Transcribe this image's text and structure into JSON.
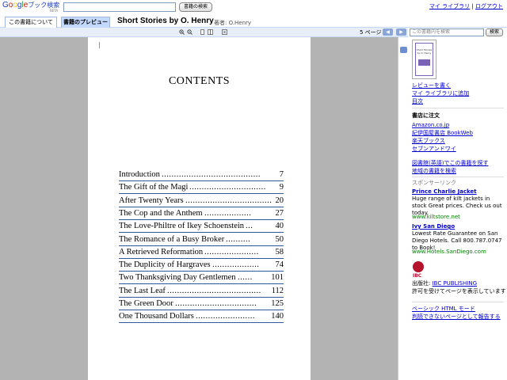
{
  "header": {
    "logo": {
      "g1": "G",
      "o1": "o",
      "o2": "o",
      "g2": "g",
      "l": "l",
      "e": "e",
      "jp": "ブック検索"
    },
    "logo_sub": "BETA",
    "search_button": "書籍の検索",
    "my_library": "マイ ライブラリ",
    "separator": "|",
    "logout": "ログアウト"
  },
  "tabs": {
    "about": "この書籍について",
    "preview": "書籍のプレビュー"
  },
  "book": {
    "title": "Short Stories by O. Henry",
    "author_label": "著者: O.Henry"
  },
  "toolbar": {
    "page_indicator": "5 ページ",
    "prev": "◀",
    "next": "▶"
  },
  "page": {
    "heading": "CONTENTS",
    "toc": [
      {
        "title": "Introduction",
        "dots": "........................................",
        "page": "7"
      },
      {
        "title": "The Gift of the Magi",
        "dots": "...............................",
        "page": "9"
      },
      {
        "title": "After Twenty Years",
        "dots": ".....................................",
        "page": "20"
      },
      {
        "title": "The Cop and the Anthem",
        "dots": "...................",
        "page": "27"
      },
      {
        "title": "The Love-Philtre of Ikey Schoenstein",
        "dots": "...",
        "page": "40"
      },
      {
        "title": "The Romance of a Busy Broker",
        "dots": "..........",
        "page": "50"
      },
      {
        "title": "A Retrieved Reformation",
        "dots": "......................",
        "page": "58"
      },
      {
        "title": "The Duplicity of Hargraves",
        "dots": "...................",
        "page": "74"
      },
      {
        "title": "Two Thanksgiving Day Gentlemen",
        "dots": "......",
        "page": "101"
      },
      {
        "title": "The Last Leaf",
        "dots": "......................................",
        "page": "112"
      },
      {
        "title": "The Green Door",
        "dots": ".................................",
        "page": "125"
      },
      {
        "title": "One Thousand Dollars",
        "dots": "........................",
        "page": "140"
      }
    ]
  },
  "sidebar": {
    "inbook_search_placeholder": "この書籍内を検索",
    "inbook_search_button": "検索",
    "cover_text": "Short Stories by O. Henry",
    "write_review": "レビューを書く",
    "add_to_library": "マイ ライブラリに追加",
    "toc_link": "目次",
    "buy_heading": "書店に注文",
    "stores": [
      "Amazon.co.jp",
      "紀伊国屋書店 BookWeb",
      "楽天ブックス",
      "セブンアンドワイ"
    ],
    "library_links": [
      "図書館(英語)でこの書籍を探す",
      "地域の書籍を検索"
    ],
    "sponsored_label": "スポンサーリンク",
    "ads": [
      {
        "title": "Prince Charlie Jacket",
        "text": "Huge range of kilt jackets in stock Great prices. Check us out today.",
        "url": "www.kiltstore.net"
      },
      {
        "title": "Ivy San Diego",
        "text": "Lowest Rate Guarantee on San Diego Hotels. Call 800.787.0747 to Book!",
        "url": "www.Hotels.SanDiego.com"
      }
    ],
    "publisher_logo_text": "IBC",
    "publisher_label": "出版社:",
    "publisher_name": "IBC PUBLISHING",
    "permission": "許可を受けてページを表示しています",
    "footer_links": [
      "ベーシック HTML モード",
      "判読できないページとして報告する"
    ]
  },
  "colors": {
    "link": "#0000cc",
    "tab_active": "#c3d9ff",
    "viewer_bg": "#b3b3b3",
    "toc_underline": "#34569a",
    "ad_url": "#008000"
  }
}
